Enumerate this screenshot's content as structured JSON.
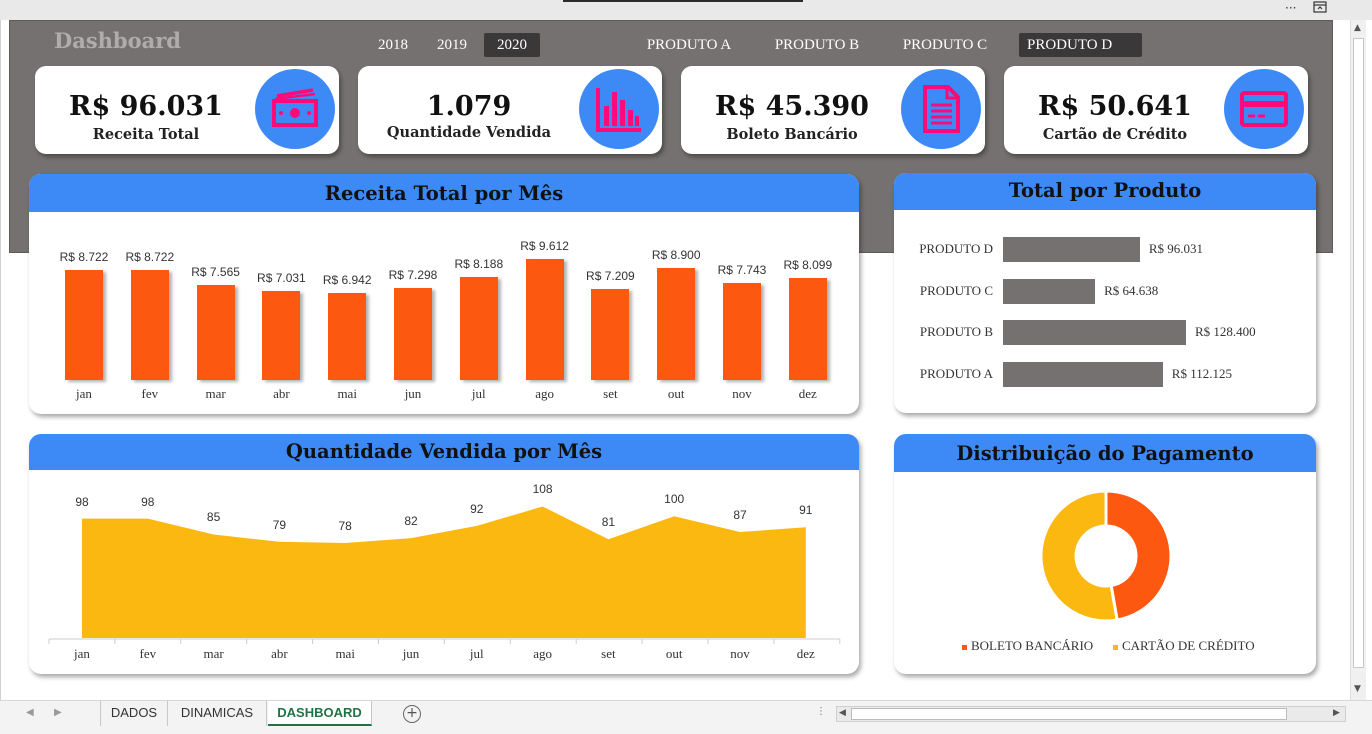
{
  "window": {
    "more_icon": "ellipsis-icon",
    "restore_icon": "ribbon-display-icon"
  },
  "dashboard": {
    "title": "Dashboard"
  },
  "year_slicer": {
    "items": [
      "2018",
      "2019",
      "2020"
    ],
    "selected": "2020"
  },
  "product_slicer": {
    "items": [
      "PRODUTO A",
      "PRODUTO B",
      "PRODUTO C",
      "PRODUTO D"
    ],
    "selected": "PRODUTO D"
  },
  "kpis": [
    {
      "value": "R$ 96.031",
      "label": "Receita Total",
      "icon": "money-bills-icon"
    },
    {
      "value": "1.079",
      "label": "Quantidade Vendida",
      "icon": "bar-chart-icon"
    },
    {
      "value": "R$ 45.390",
      "label": "Boleto Bancário",
      "icon": "document-icon"
    },
    {
      "value": "R$ 50.641",
      "label": "Cartão de Crédito",
      "icon": "credit-card-icon"
    }
  ],
  "colors": {
    "accent": "#3d8af7",
    "bar": "#fc5810",
    "area": "#fbb811",
    "gray": "#767171",
    "icon": "#ff0a78",
    "sheet_tab": "#217346"
  },
  "revenue_chart": {
    "title": "Receita Total por Mês",
    "chart_data": {
      "type": "bar",
      "categories": [
        "jan",
        "fev",
        "mar",
        "abr",
        "mai",
        "jun",
        "jul",
        "ago",
        "set",
        "out",
        "nov",
        "dez"
      ],
      "values": [
        8722,
        8722,
        7565,
        7031,
        6942,
        7298,
        8188,
        9612,
        7209,
        8900,
        7743,
        8099
      ],
      "labels": [
        "R$ 8.722",
        "R$ 8.722",
        "R$ 7.565",
        "R$ 7.031",
        "R$ 6.942",
        "R$ 7.298",
        "R$ 8.188",
        "R$ 9.612",
        "R$ 7.209",
        "R$ 8.900",
        "R$ 7.743",
        "R$ 8.099"
      ]
    }
  },
  "quantity_chart": {
    "title": "Quantidade Vendida por Mês",
    "chart_data": {
      "type": "area",
      "categories": [
        "jan",
        "fev",
        "mar",
        "abr",
        "mai",
        "jun",
        "jul",
        "ago",
        "set",
        "out",
        "nov",
        "dez"
      ],
      "values": [
        98,
        98,
        85,
        79,
        78,
        82,
        92,
        108,
        81,
        100,
        87,
        91
      ]
    }
  },
  "product_chart": {
    "title": "Total por Produto",
    "chart_data": {
      "type": "bar",
      "orientation": "horizontal",
      "categories": [
        "PRODUTO D",
        "PRODUTO C",
        "PRODUTO B",
        "PRODUTO A"
      ],
      "values": [
        96031,
        64638,
        128400,
        112125
      ],
      "labels": [
        "R$ 96.031",
        "R$ 64.638",
        "R$ 128.400",
        "R$ 112.125"
      ]
    }
  },
  "payment_chart": {
    "title": "Distribuição do Pagamento",
    "chart_data": {
      "type": "pie",
      "donut": true,
      "categories": [
        "BOLETO BANCÁRIO",
        "CARTÃO DE CRÉDITO"
      ],
      "values": [
        45390,
        50641
      ],
      "colors": [
        "#fc5810",
        "#fbb811"
      ],
      "legend": "bottom"
    }
  },
  "sheet_tabs": {
    "items": [
      "DADOS",
      "DINAMICAS",
      "DASHBOARD"
    ],
    "active": "DASHBOARD"
  }
}
